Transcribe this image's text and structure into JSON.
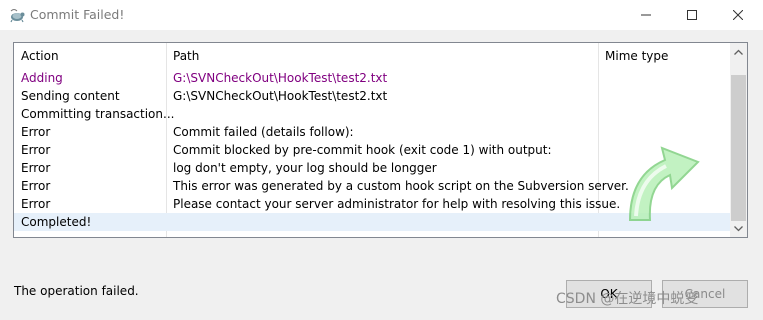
{
  "window": {
    "title": "Commit Failed!",
    "controls": {
      "minimize": "minimize",
      "maximize": "maximize",
      "close": "close"
    }
  },
  "list": {
    "columns": [
      "Action",
      "Path",
      "Mime type"
    ],
    "rows": [
      {
        "action": "Adding",
        "path": "G:\\SVNCheckOut\\HookTest\\test2.txt",
        "color": "#800080"
      },
      {
        "action": "Sending content",
        "path": "G:\\SVNCheckOut\\HookTest\\test2.txt",
        "color": "#000000"
      },
      {
        "action": "Committing transaction...",
        "path": "",
        "color": "#000000"
      },
      {
        "action": "Error",
        "path": "Commit failed (details follow):",
        "color": "#000000"
      },
      {
        "action": "Error",
        "path": "Commit blocked by pre-commit hook (exit code 1) with output:",
        "color": "#000000"
      },
      {
        "action": "Error",
        "path": "log don't empty, your log should be longger",
        "color": "#000000"
      },
      {
        "action": "Error",
        "path": "This error was generated by a custom hook script on the Subversion server.",
        "color": "#000000"
      },
      {
        "action": "Error",
        "path": "Please contact your server administrator for help with resolving this issue.",
        "color": "#000000"
      },
      {
        "action": "Completed!",
        "path": "",
        "color": "#000000",
        "selected": true
      }
    ]
  },
  "footer": {
    "status": "The operation failed.",
    "ok_label": "OK",
    "cancel_label": "Cancel",
    "watermark": "CSDN @在逆境中蜕变"
  },
  "colors": {
    "selection": "#e6f0fa",
    "adding": "#800080",
    "arrow": "#9be69b"
  }
}
